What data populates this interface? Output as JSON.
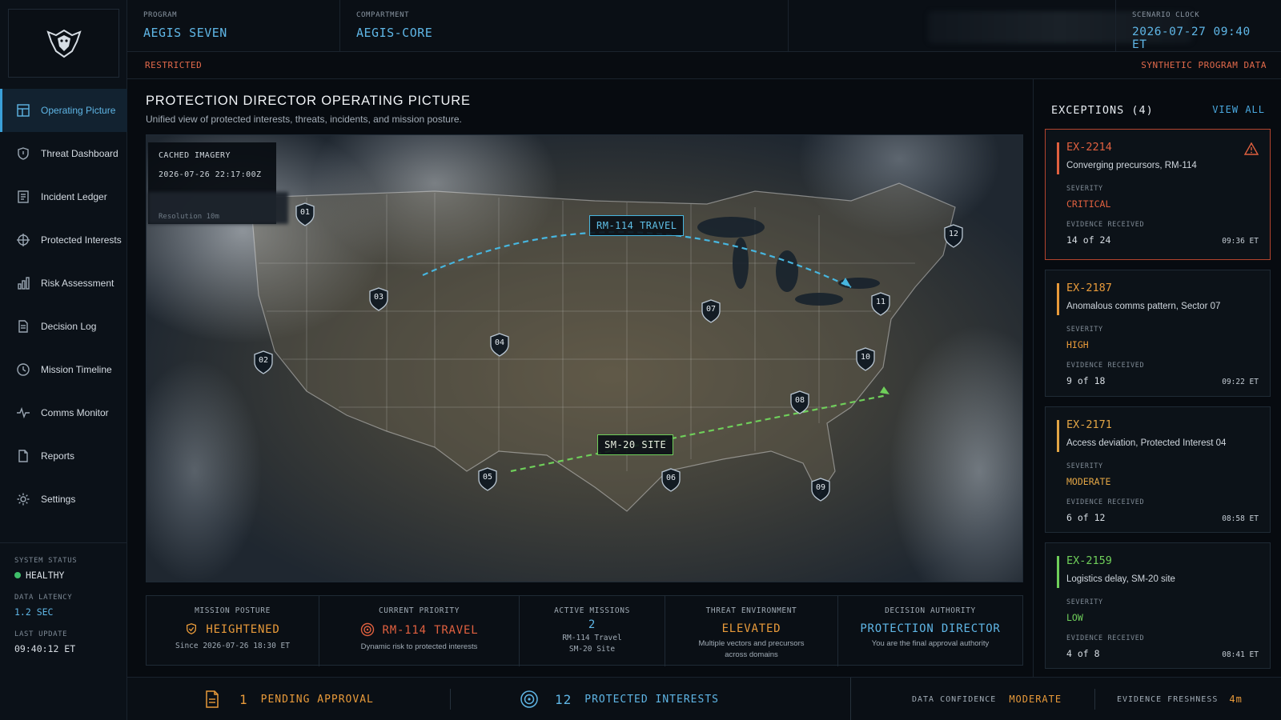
{
  "top": {
    "program_label": "PROGRAM",
    "program_value": "AEGIS SEVEN",
    "compartment_label": "COMPARTMENT",
    "compartment_value": "AEGIS-CORE",
    "clock_label": "SCENARIO CLOCK",
    "clock_value": "2026-07-27 09:40 ET",
    "restricted": "RESTRICTED",
    "synthetic": "SYNTHETIC PROGRAM DATA"
  },
  "sidebar": {
    "items": [
      {
        "label": "Operating Picture",
        "icon": "grid-icon"
      },
      {
        "label": "Threat Dashboard",
        "icon": "shield-icon"
      },
      {
        "label": "Incident Ledger",
        "icon": "ledger-icon"
      },
      {
        "label": "Protected Interests",
        "icon": "crosshair-icon"
      },
      {
        "label": "Risk Assessment",
        "icon": "bar-chart-icon"
      },
      {
        "label": "Decision Log",
        "icon": "document-icon"
      },
      {
        "label": "Mission Timeline",
        "icon": "clock-icon"
      },
      {
        "label": "Comms Monitor",
        "icon": "pulse-icon"
      },
      {
        "label": "Reports",
        "icon": "file-icon"
      },
      {
        "label": "Settings",
        "icon": "gear-icon"
      }
    ],
    "system_status_label": "SYSTEM STATUS",
    "system_status_value": "HEALTHY",
    "latency_label": "DATA LATENCY",
    "latency_value": "1.2 SEC",
    "last_update_label": "LAST UPDATE",
    "last_update_value": "09:40:12 ET"
  },
  "main": {
    "title": "PROTECTION DIRECTOR OPERATING PICTURE",
    "subtitle": "Unified view of protected interests, threats, incidents, and mission posture.",
    "cache_label": "CACHED IMAGERY",
    "cache_time": "2026-07-26 22:17:00Z",
    "cache_res": "Resolution 10m",
    "markers": [
      "01",
      "02",
      "03",
      "04",
      "05",
      "06",
      "07",
      "08",
      "09",
      "10",
      "11",
      "12"
    ],
    "routes": [
      {
        "label": "RM-114 TRAVEL",
        "color": "#47b6df"
      },
      {
        "label": "SM-20 SITE",
        "color": "#6fcf5a"
      }
    ]
  },
  "kpis": {
    "posture_label": "MISSION POSTURE",
    "posture_value": "HEIGHTENED",
    "posture_sub": "Since 2026-07-26 18:30 ET",
    "priority_label": "CURRENT PRIORITY",
    "priority_value": "RM-114 TRAVEL",
    "priority_sub": "Dynamic risk to protected interests",
    "missions_label": "ACTIVE MISSIONS",
    "missions_value": "2",
    "missions_sub1": "RM-114 Travel",
    "missions_sub2": "SM-20 Site",
    "threat_label": "THREAT ENVIRONMENT",
    "threat_value": "ELEVATED",
    "threat_sub1": "Multiple vectors and precursors",
    "threat_sub2": "across domains",
    "authority_label": "DECISION AUTHORITY",
    "authority_value": "PROTECTION DIRECTOR",
    "authority_sub": "You are the final approval authority"
  },
  "exceptions": {
    "title": "EXCEPTIONS (4)",
    "view_all": "VIEW ALL",
    "severity_label": "SEVERITY",
    "evidence_label": "EVIDENCE RECEIVED",
    "items": [
      {
        "id": "EX-2214",
        "desc": "Converging precursors, RM-114",
        "severity": "CRITICAL",
        "evidence": "14 of 24",
        "time": "09:36 ET",
        "color": "#e0603f"
      },
      {
        "id": "EX-2187",
        "desc": "Anomalous comms pattern, Sector 07",
        "severity": "HIGH",
        "evidence": "9 of 18",
        "time": "09:22 ET",
        "color": "#e89a3a"
      },
      {
        "id": "EX-2171",
        "desc": "Access deviation, Protected Interest 04",
        "severity": "MODERATE",
        "evidence": "6 of 12",
        "time": "08:58 ET",
        "color": "#e2a545"
      },
      {
        "id": "EX-2159",
        "desc": "Logistics delay, SM-20 site",
        "severity": "LOW",
        "evidence": "4 of 8",
        "time": "08:41 ET",
        "color": "#6fcf5a"
      }
    ]
  },
  "footer": {
    "pending_count": "1",
    "pending_label": "PENDING APPROVAL",
    "protected_count": "12",
    "protected_label": "PROTECTED INTERESTS",
    "confidence_label": "DATA CONFIDENCE",
    "confidence_value": "MODERATE",
    "freshness_label": "EVIDENCE FRESHNESS",
    "freshness_value": "4m"
  },
  "colors": {
    "accent": "#4aa9e0",
    "warning": "#e89a3a",
    "critical": "#e0603f",
    "ok": "#3fbf6a"
  }
}
